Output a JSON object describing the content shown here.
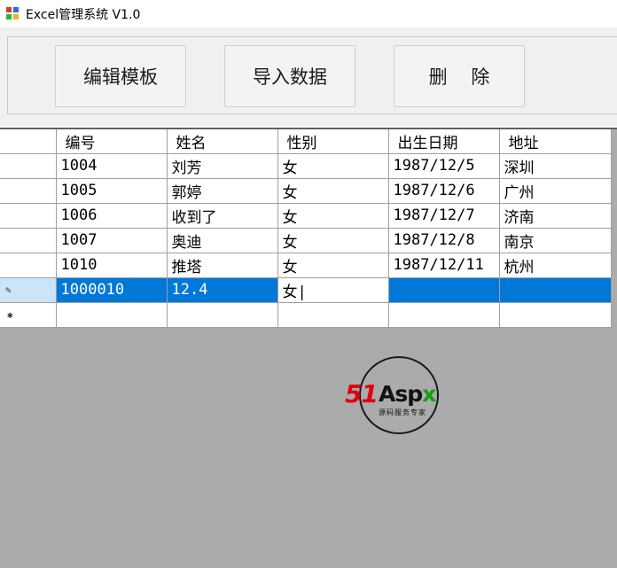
{
  "window": {
    "title": "Excel管理系统 V1.0",
    "icon": "excel-app-icon"
  },
  "toolbar": {
    "edit_template_label": "编辑模板",
    "import_data_label": "导入数据",
    "delete_label": "删    除"
  },
  "grid": {
    "columns": [
      "编号",
      "姓名",
      "性别",
      "出生日期",
      "地址"
    ],
    "rows": [
      [
        "1004",
        "刘芳",
        "女",
        "1987/12/5",
        "深圳"
      ],
      [
        "1005",
        "郭婷",
        "女",
        "1987/12/6",
        "广州"
      ],
      [
        "1006",
        "收到了",
        "女",
        "1987/12/7",
        "济南"
      ],
      [
        "1007",
        "奥迪",
        "女",
        "1987/12/8",
        "南京"
      ],
      [
        "1010",
        "推塔",
        "女",
        "1987/12/11",
        "杭州"
      ],
      [
        "1000010",
        "12.4",
        "女|",
        "",
        ""
      ]
    ],
    "selected_row_index": 5,
    "editing_row_icon": "pencil-icon",
    "new_row_icon": "asterisk-icon",
    "selection_color": "#0078d7",
    "background_color": "#ababab"
  },
  "watermark": {
    "brand_51": "51",
    "brand_asp": "Asp",
    "brand_x": "x",
    "tagline": "源码服务专家"
  }
}
